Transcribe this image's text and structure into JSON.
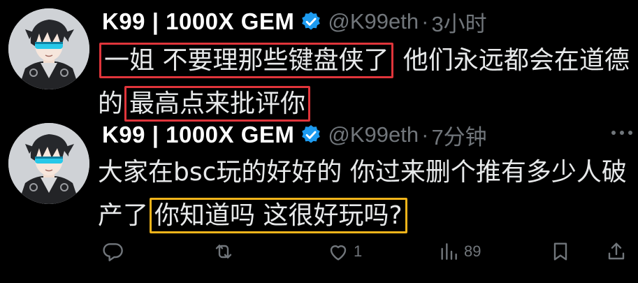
{
  "tweets": [
    {
      "author": {
        "display_name": "K99 | 1000X GEM",
        "handle": "@K99eth",
        "verified_icon": "verified-badge-icon"
      },
      "separator": "·",
      "time": "3小时",
      "text_segments": [
        {
          "text": "一姐 不要理那些键盘侠了",
          "highlight": "red"
        },
        {
          "text": " 他们永远都会在道德的",
          "highlight": null
        },
        {
          "text": "最高点来批评你",
          "highlight": "red"
        }
      ]
    },
    {
      "author": {
        "display_name": "K99 | 1000X GEM",
        "handle": "@K99eth",
        "verified_icon": "verified-badge-icon"
      },
      "separator": "·",
      "time": "7分钟",
      "text_segments": [
        {
          "text": "大家在bsc玩的好好的 你过来删个推有多少人破产了",
          "highlight": null
        },
        {
          "text": "你知道吗 这很好玩吗?",
          "highlight": "yellow"
        }
      ],
      "actions": {
        "reply": {
          "icon": "reply-icon",
          "count": ""
        },
        "repost": {
          "icon": "repost-icon",
          "count": ""
        },
        "like": {
          "icon": "heart-icon",
          "count": "1"
        },
        "views": {
          "icon": "views-chart-icon",
          "count": "89"
        },
        "bookmark": {
          "icon": "bookmark-icon"
        },
        "share": {
          "icon": "share-icon"
        }
      }
    }
  ],
  "colors": {
    "background": "#000000",
    "text": "#e7e9ea",
    "muted": "#71767b",
    "verified": "#1d9bf0",
    "highlight_red": "#e0353b",
    "highlight_yellow": "#f1b41a"
  }
}
